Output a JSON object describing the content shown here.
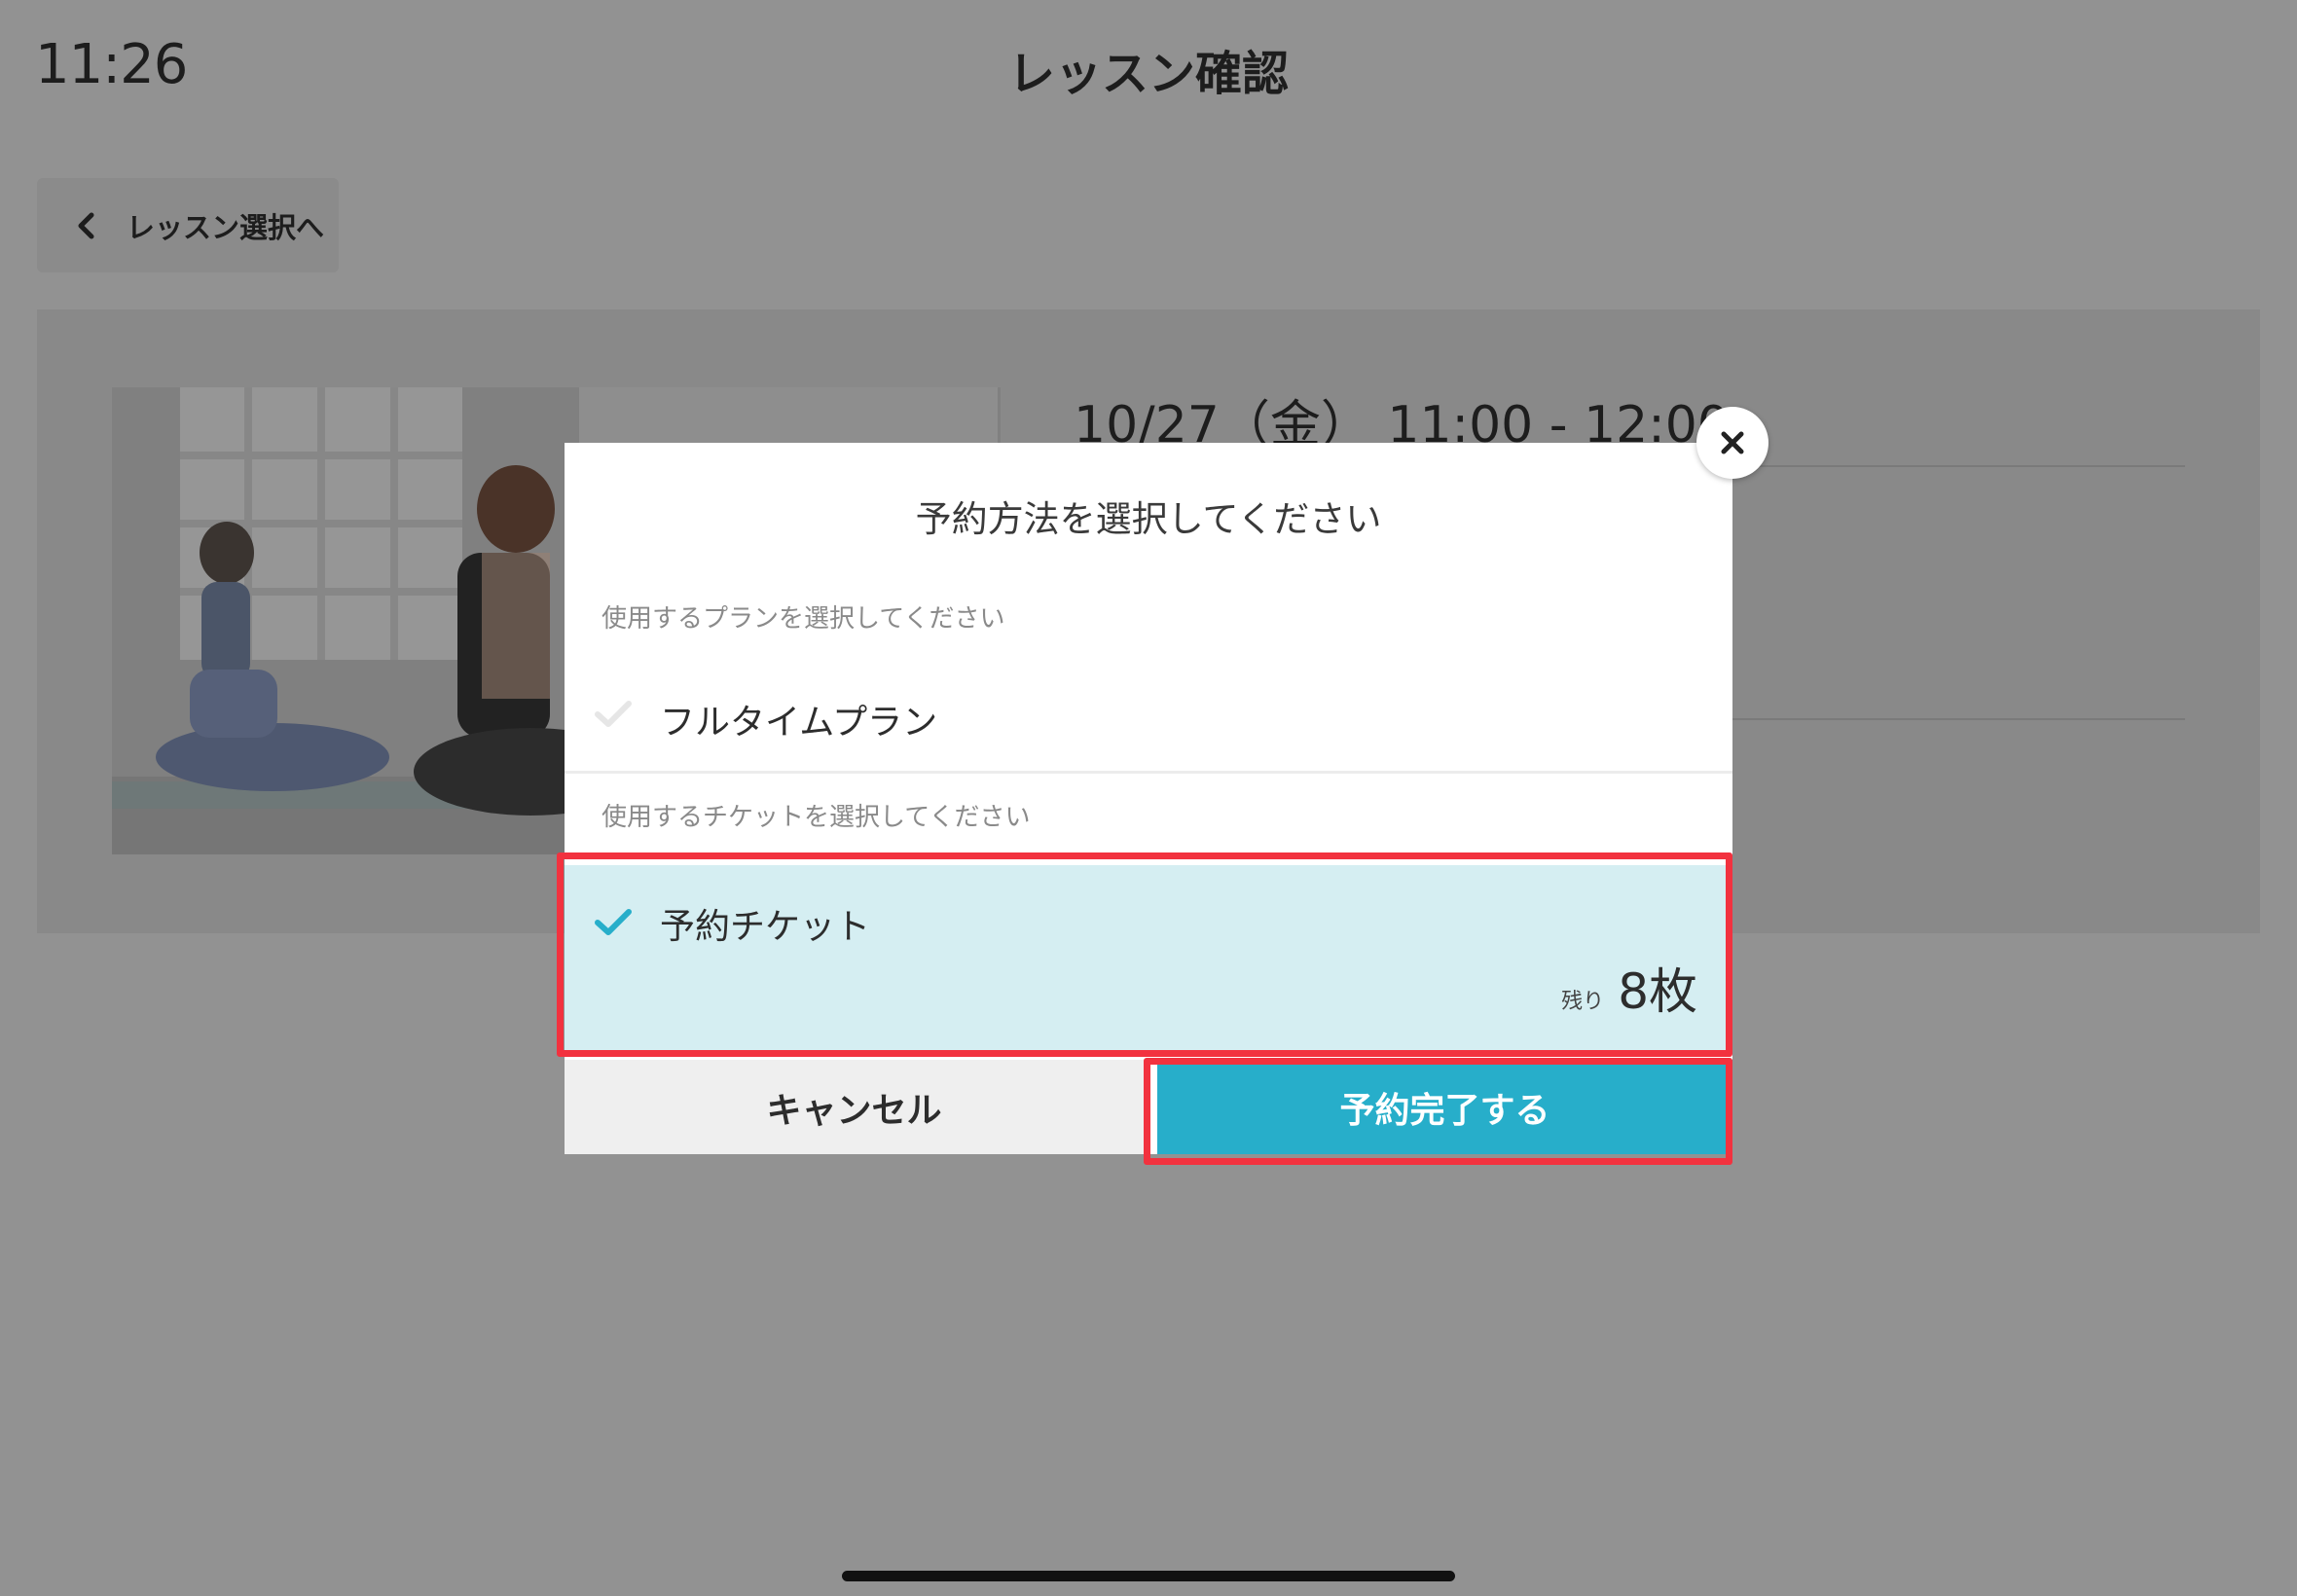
{
  "status_bar": {
    "time": "11:26"
  },
  "header": {
    "title": "レッスン確認"
  },
  "back_button": {
    "label": "レッスン選択へ",
    "icon": "chevron-left-icon"
  },
  "lesson": {
    "datetime": "10/27（金） 11:00 - 12:00",
    "photo": "yoga-class-photo"
  },
  "modal": {
    "title": "予約方法を選択してください",
    "plan_section_label": "使用するプランを選択してください",
    "plan_option": {
      "label": "フルタイムプラン",
      "selected": false
    },
    "ticket_section_label": "使用するチケットを選択してください",
    "ticket_option": {
      "label": "予約チケット",
      "selected": true,
      "remaining_label": "残り",
      "remaining_count": "8枚"
    },
    "cancel_label": "キャンセル",
    "confirm_label": "予約完了する",
    "close_icon": "close-icon"
  },
  "colors": {
    "accent": "#27aeca",
    "selected_row": "#d5eef2",
    "highlight": "#f2323f",
    "overlay_bg": "#929292"
  }
}
